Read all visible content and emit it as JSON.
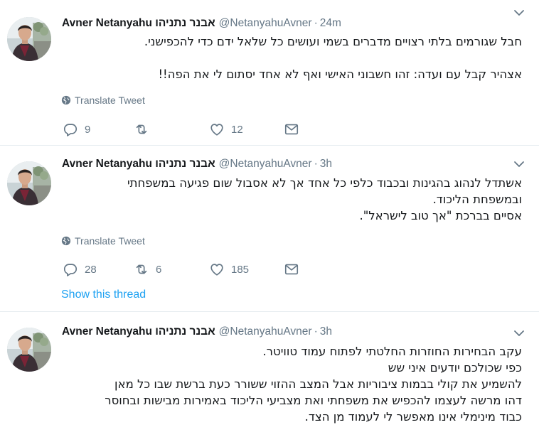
{
  "colors": {
    "accent": "#1da1f2",
    "secondary_text": "#657786",
    "divider": "#e6ecf0"
  },
  "tweets": [
    {
      "name": "Avner Netanyahu אבנר נתניהו",
      "handle": "@NetanyahuAvner",
      "time": "24m",
      "lines": [
        "חבל שגורמים בלתי רצויים מדברים בשמי ועושים כל שלאל ידם כדי להכפישני.",
        "",
        "אצהיר קבל עם ועדה: זהו חשבוני האישי ואף לא אחד יסתום לי את הפה!!"
      ],
      "translate": "Translate Tweet",
      "replies": "9",
      "retweets": "",
      "likes": "12"
    },
    {
      "name": "Avner Netanyahu אבנר נתניהו",
      "handle": "@NetanyahuAvner",
      "time": "3h",
      "lines": [
        "אשתדל לנהוג בהגינות ובכבוד כלפי כל אחד אך לא אסבול שום פגיעה במשפחתי",
        "ובמשפחת הליכוד.",
        "אסיים בברכת \"אך טוב לישראל\"."
      ],
      "translate": "Translate Tweet",
      "replies": "28",
      "retweets": "6",
      "likes": "185",
      "show_thread": "Show this thread"
    },
    {
      "name": "Avner Netanyahu אבנר נתניהו",
      "handle": "@NetanyahuAvner",
      "time": "3h",
      "lines": [
        "עקב הבחירות החוזרות החלטתי לפתוח עמוד טוויטר.",
        "כפי שכולכם יודעים איני שש",
        "להשמיע את קולי בבמות ציבוריות אבל המצב ההזוי ששורר כעת ברשת שבו כל מאן",
        "דהו מרשה לעצמו להכפיש את משפחתי ואת מצביעי הליכוד באמירות מבישות ובחוסר",
        "כבוד מינימלי אינו מאפשר לי לעמוד מן הצד."
      ]
    }
  ]
}
